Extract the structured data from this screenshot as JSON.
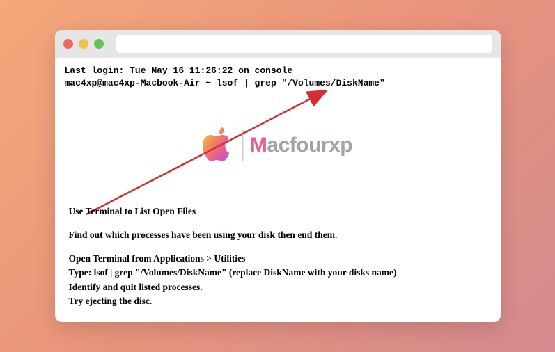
{
  "terminal": {
    "last_login": "Last login: Tue May 16 11:26:22 on console",
    "prompt": "mac4xp@mac4xp-Macbook-Air ~  lsof | grep \"/Volumes/DiskName\""
  },
  "watermark": {
    "brand_prefix": "M",
    "brand_rest": "acfourxp"
  },
  "instructions": {
    "heading": "Use Terminal to List Open Files",
    "intro": "Find out which processes have been using your disk then end them.",
    "step1": "Open Terminal from Applications > Utilities",
    "step2": "Type: lsof | grep \"/Volumes/DiskName\" (replace DiskName with your disks name)",
    "step3": "Identify and quit listed processes.",
    "step4": "Try ejecting the disc."
  },
  "colors": {
    "arrow": "#d32f2f"
  }
}
